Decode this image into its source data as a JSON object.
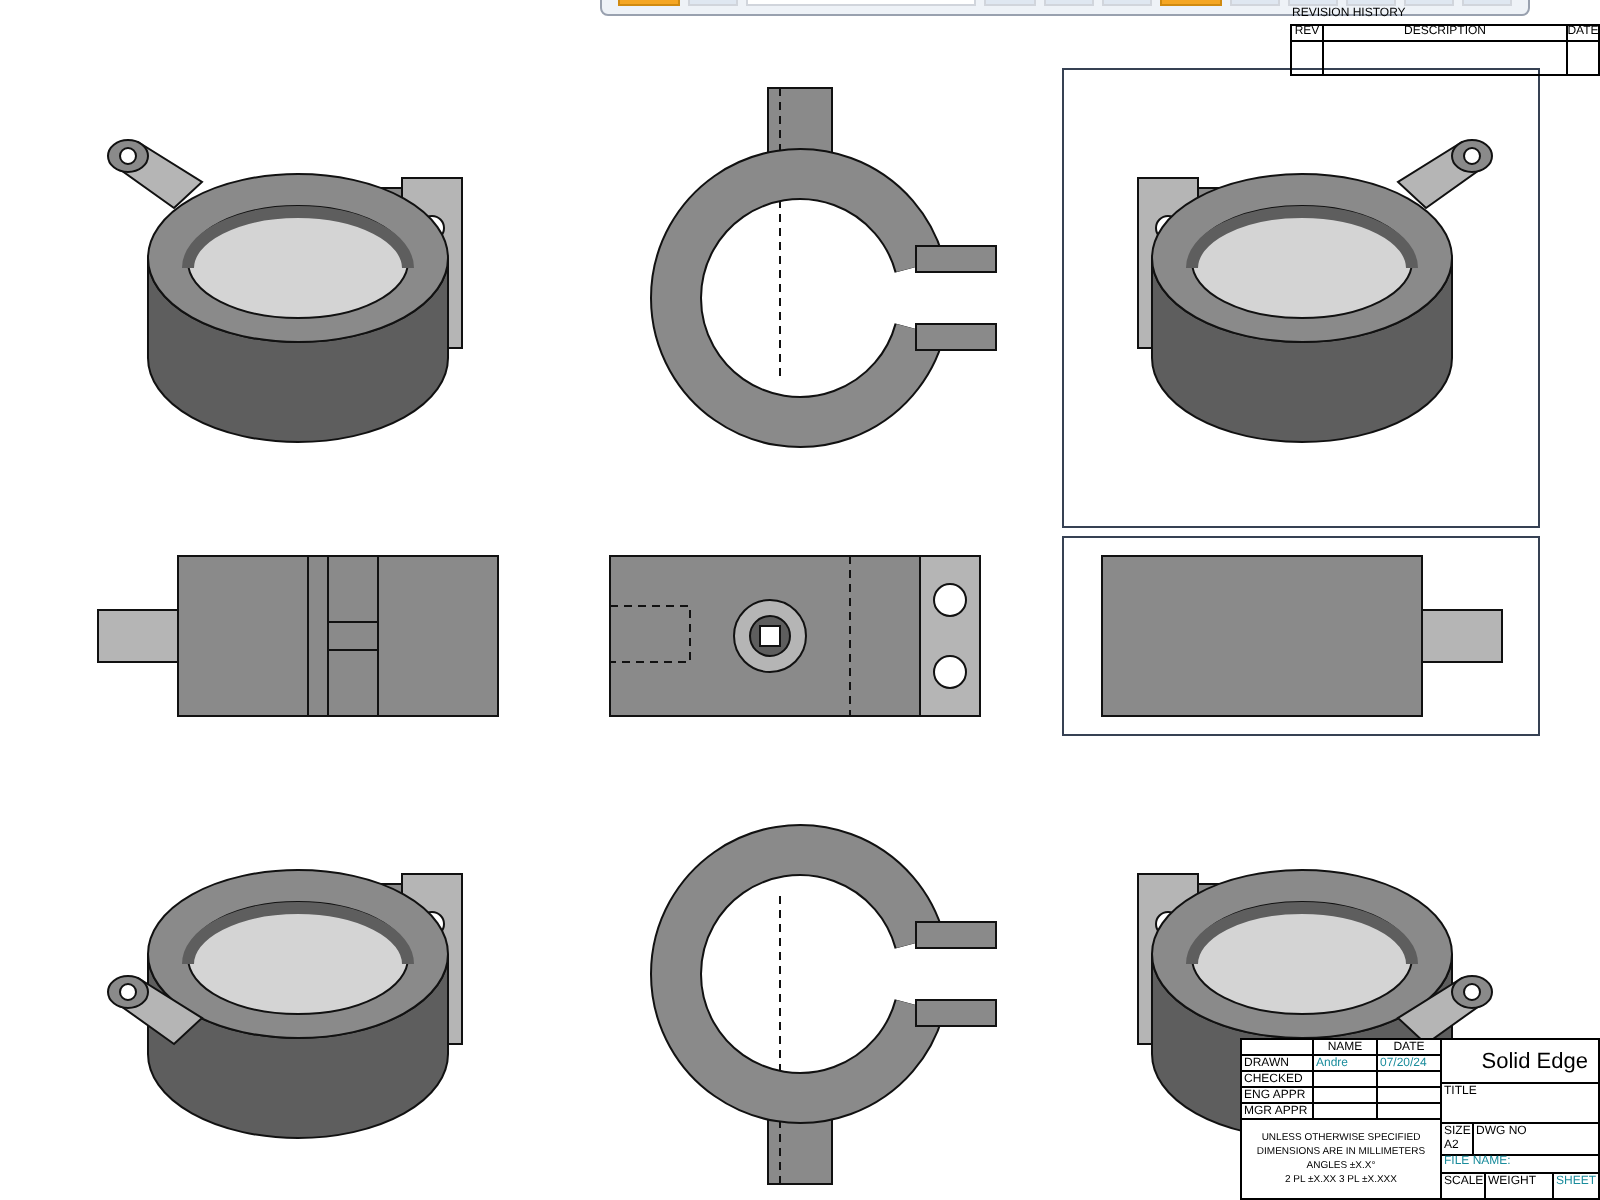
{
  "toolbar": {
    "buttons": [
      {
        "kind": "accent"
      },
      {
        "kind": "plain"
      },
      {
        "kind": "field"
      },
      {
        "kind": "plain"
      },
      {
        "kind": "plain"
      },
      {
        "kind": "plain"
      },
      {
        "kind": "accent"
      },
      {
        "kind": "plain"
      },
      {
        "kind": "plain"
      },
      {
        "kind": "plain"
      },
      {
        "kind": "plain"
      },
      {
        "kind": "plain"
      }
    ]
  },
  "revision_table": {
    "title": "REVISION HISTORY",
    "columns": [
      "REV",
      "DESCRIPTION",
      "DATE"
    ]
  },
  "views": [
    {
      "kind": "iso_front_left",
      "framed": false
    },
    {
      "kind": "ring_tube_up",
      "framed": false
    },
    {
      "kind": "iso_back_left",
      "framed": true
    },
    {
      "kind": "side_tube_left",
      "framed": false
    },
    {
      "kind": "top_tabs_right",
      "framed": false
    },
    {
      "kind": "side_tube_right",
      "framed": true
    },
    {
      "kind": "iso_below_left",
      "framed": false
    },
    {
      "kind": "ring_tube_down",
      "framed": false
    },
    {
      "kind": "iso_below_right",
      "framed": false
    }
  ],
  "title_block": {
    "header": [
      "NAME",
      "DATE"
    ],
    "rows": [
      {
        "label": "DRAWN",
        "name": "Andre",
        "date": "07/20/24"
      },
      {
        "label": "CHECKED",
        "name": "",
        "date": ""
      },
      {
        "label": "ENG APPR",
        "name": "",
        "date": ""
      },
      {
        "label": "MGR APPR",
        "name": "",
        "date": ""
      }
    ],
    "tolerance_note": [
      "UNLESS OTHERWISE SPECIFIED",
      "DIMENSIONS ARE IN MILLIMETERS",
      "ANGLES ±X.X°",
      "2 PL ±X.XX 3 PL ±X.XXX"
    ],
    "brand": "Solid Edge",
    "title_label": "TITLE",
    "size_label": "SIZE",
    "size": "A2",
    "dwg_label": "DWG NO",
    "file_label": "FILE NAME:",
    "scale_label": "SCALE",
    "weight_label": "WEIGHT",
    "sheet_label": "SHEET"
  }
}
